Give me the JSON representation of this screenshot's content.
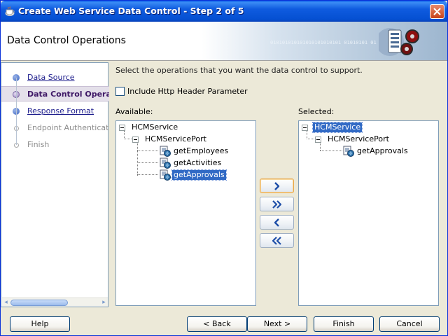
{
  "window": {
    "title": "Create Web Service Data Control - Step 2 of 5"
  },
  "header": {
    "title": "Data Control Operations",
    "binary_deco": "010101010101010101010101 01010101 01"
  },
  "steps": [
    {
      "label": "Data Source",
      "state": "link"
    },
    {
      "label": "Data Control Operations",
      "state": "current"
    },
    {
      "label": "Response Format",
      "state": "link"
    },
    {
      "label": "Endpoint Authentication",
      "state": "disabled"
    },
    {
      "label": "Finish",
      "state": "disabled"
    }
  ],
  "main": {
    "instruction": "Select the operations that you want the data control to support.",
    "include_header_label": "Include Http Header Parameter",
    "include_header_checked": false,
    "available_label": "Available:",
    "selected_label": "Selected:"
  },
  "available_tree": {
    "service": "HCMService",
    "port": "HCMServicePort",
    "operations": [
      "getEmployees",
      "getActivities",
      "getApprovals"
    ],
    "highlighted": "getApprovals"
  },
  "selected_tree": {
    "service": "HCMService",
    "port": "HCMServicePort",
    "operations": [
      "getApprovals"
    ],
    "highlighted": "HCMService"
  },
  "move_buttons": [
    "add-selected-icon",
    "add-all-icon",
    "remove-selected-icon",
    "remove-all-icon"
  ],
  "footer": {
    "help": "Help",
    "back": "< Back",
    "next": "Next >",
    "finish": "Finish",
    "cancel": "Cancel"
  },
  "colors": {
    "title_bar": "#0550d2",
    "selection": "#316ac5",
    "current_step": "#3e1866",
    "link": "#1c1c8c"
  }
}
